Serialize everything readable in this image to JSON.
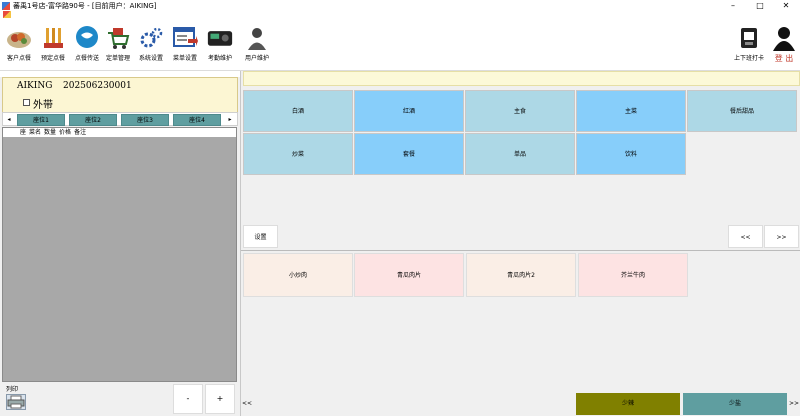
{
  "window": {
    "title": "蕃禹1号店-富华路90号 - [目前用户：AIKING]",
    "minimize": "–",
    "maximize": "□",
    "close": "✕"
  },
  "toolbar": {
    "buttons": [
      {
        "label": "客户点餐",
        "icon": "food-plate-icon"
      },
      {
        "label": "预定点餐",
        "icon": "chopsticks-icon"
      },
      {
        "label": "点餐传送",
        "icon": "chat-bubble-icon"
      },
      {
        "label": "定单管理",
        "icon": "shopping-cart-icon"
      },
      {
        "label": "系统设置",
        "icon": "gears-icon"
      },
      {
        "label": "菜单设置",
        "icon": "menu-window-icon"
      },
      {
        "label": "考勤维护",
        "icon": "time-clock-icon"
      },
      {
        "label": "用户维护",
        "icon": "user-silhouette-icon"
      }
    ],
    "right_buttons": [
      {
        "label": "上下班打卡",
        "icon": "punch-card-icon"
      },
      {
        "label": "登 出",
        "icon": "logout-user-icon"
      }
    ]
  },
  "order": {
    "user": "AIKING",
    "number": "202506230001",
    "takeout_label": "外带",
    "takeout_checked": false
  },
  "seats": {
    "prev": "◂",
    "next": "▸",
    "items": [
      "座位1",
      "座位2",
      "座位3",
      "座位4"
    ]
  },
  "order_grid": {
    "columns": [
      "座",
      "菜名",
      "数量",
      "价格",
      "备注"
    ]
  },
  "left_bottom": {
    "print_label": "列印",
    "minus": "-",
    "plus": "+"
  },
  "categories": [
    {
      "label": "白酒",
      "color": "#add8e6"
    },
    {
      "label": "红酒",
      "color": "#87cefa"
    },
    {
      "label": "主食",
      "color": "#add8e6"
    },
    {
      "label": "主菜",
      "color": "#87cefa"
    },
    {
      "label": "餐后甜品",
      "color": "#add8e6"
    },
    {
      "label": "炒菜",
      "color": "#add8e6"
    },
    {
      "label": "套餐",
      "color": "#87cefa"
    },
    {
      "label": "单品",
      "color": "#add8e6"
    },
    {
      "label": "饮料",
      "color": "#87cefa"
    }
  ],
  "mid": {
    "settings": "设置",
    "page_prev": "<<",
    "page_next": ">>"
  },
  "dishes": [
    {
      "label": "小炒肉",
      "color": "#faeee6"
    },
    {
      "label": "青瓜肉片",
      "color": "#fde3e3"
    },
    {
      "label": "青瓜肉片2",
      "color": "#faeee6"
    },
    {
      "label": "芥兰牛肉",
      "color": "#fde3e3"
    }
  ],
  "footer": {
    "left_arrow": "<<",
    "less_spicy": "少辣",
    "less_salt": "少盐",
    "right_arrow": ">>",
    "less_spicy_color": "#808000",
    "less_salt_color": "#5f9ea0"
  }
}
